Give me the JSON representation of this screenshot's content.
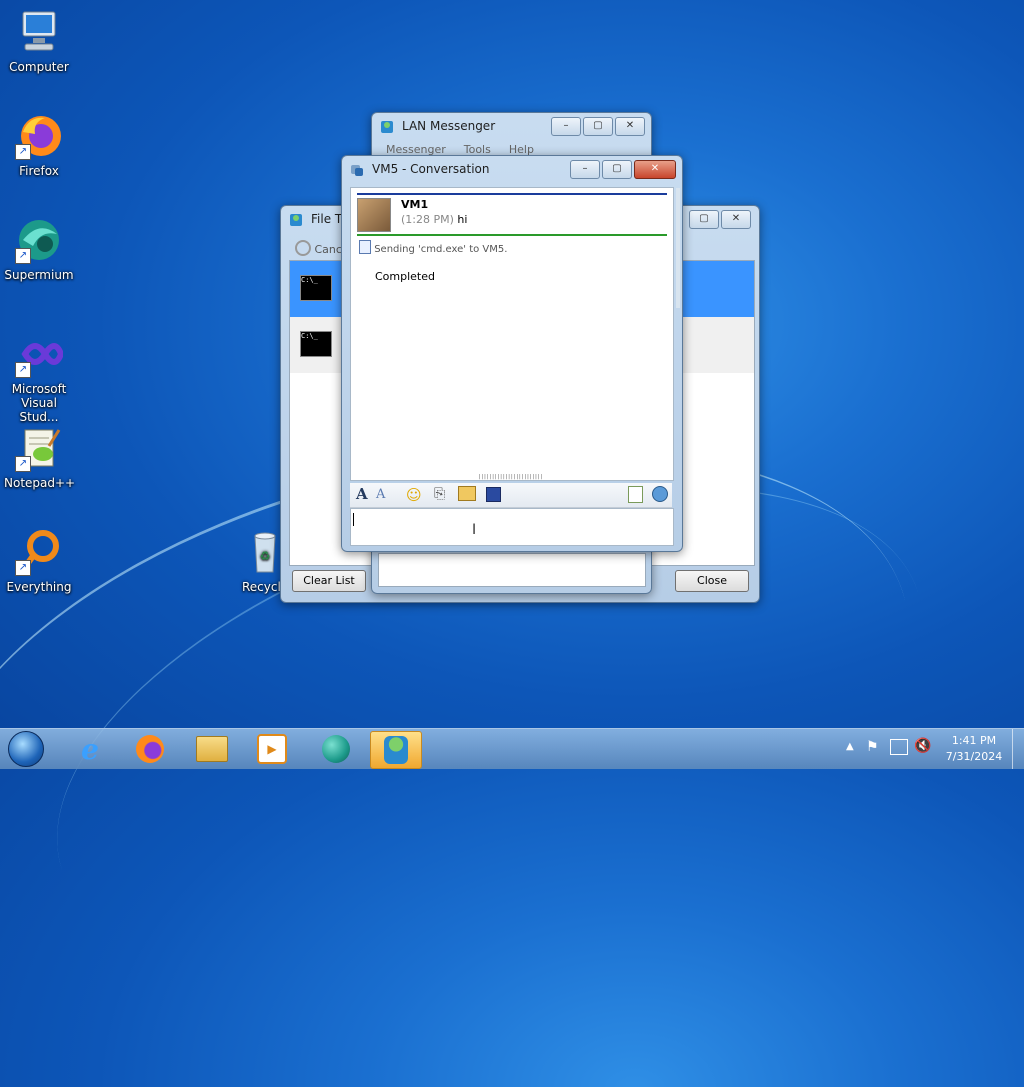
{
  "desktop": {
    "icons": [
      {
        "label": "Computer"
      },
      {
        "label": "Firefox"
      },
      {
        "label": "Supermium"
      },
      {
        "label": "Microsoft Visual Stud..."
      },
      {
        "label": "Notepad++"
      },
      {
        "label": "Everything"
      },
      {
        "label": "Recycle"
      }
    ]
  },
  "lan_messenger": {
    "title": "LAN Messenger",
    "menu": [
      "Messenger",
      "Tools",
      "Help"
    ]
  },
  "file_transfer": {
    "title": "File Tr",
    "cancel_label": "Cance",
    "clear_list_label": "Clear List",
    "close_label": "Close"
  },
  "conversation": {
    "title": "VM5 - Conversation",
    "sender": "VM1",
    "time": "(1:28 PM)",
    "message": "hi",
    "sending_text": "Sending 'cmd.exe' to VM5.",
    "completed_text": "Completed",
    "input_value": ""
  },
  "tray": {
    "time": "1:41 PM",
    "date": "7/31/2024"
  },
  "colors": {
    "accent_blue": "#1a4fd0",
    "select_blue": "#3a94ff",
    "divider_green": "#2a9a2a"
  }
}
